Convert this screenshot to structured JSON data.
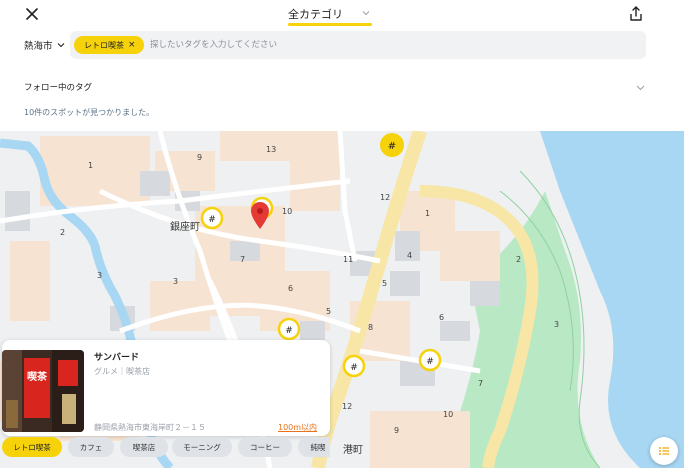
{
  "header": {
    "close_icon": "close-icon",
    "title": "全カテゴリ",
    "share_icon": "share-icon"
  },
  "search": {
    "city": "熱海市",
    "selected_tag": "レトロ喫茶",
    "placeholder": "探したいタグを入力してください"
  },
  "follow": {
    "label": "フォロー中のタグ"
  },
  "results": {
    "count_text": "10件のスポットが見つかりました。"
  },
  "map": {
    "area_label": "銀座町",
    "port_label": "港町",
    "block_numbers": [
      "1",
      "13",
      "9",
      "10",
      "12",
      "1",
      "2",
      "3",
      "3",
      "6",
      "7",
      "11",
      "4",
      "5",
      "6",
      "8",
      "5",
      "2",
      "3",
      "12",
      "10",
      "7",
      "9"
    ],
    "colors": {
      "water": "#a8d7f3",
      "road_major": "#f7e6a6",
      "park": "#b9e8c4",
      "block": "#f7e3d2",
      "building": "#d6d9de",
      "marker": "#f5d20a",
      "pin": "#e53935"
    }
  },
  "spot": {
    "name": "サンバード",
    "category": "グルメ｜喫茶店",
    "address": "静岡県熱海市東海岸町２－１５",
    "distance": "100m以内",
    "photo_text": "喫茶"
  },
  "filters": [
    {
      "label": "レトロ喫茶",
      "active": true
    },
    {
      "label": "カフェ",
      "active": false
    },
    {
      "label": "喫茶店",
      "active": false
    },
    {
      "label": "モーニング",
      "active": false
    },
    {
      "label": "コーヒー",
      "active": false
    },
    {
      "label": "純喫",
      "active": false
    }
  ],
  "fab": {
    "icon": "list-icon"
  }
}
